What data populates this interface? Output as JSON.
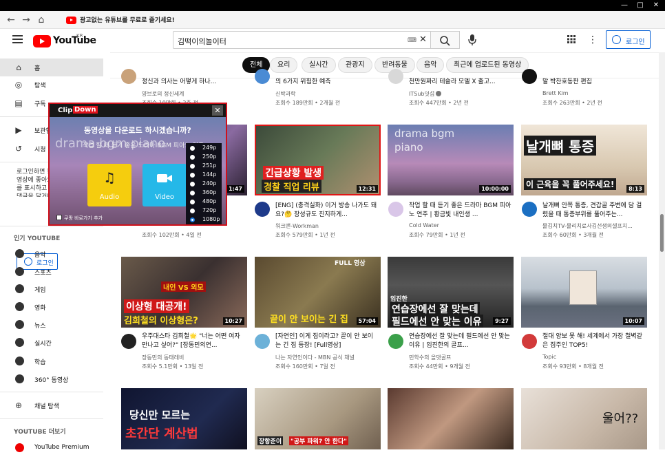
{
  "window": {
    "minimize": "—",
    "maximize": "□",
    "close": "✕"
  },
  "browser": {
    "back": "←",
    "forward": "→",
    "home": "⌂",
    "ad_text": "광고없는 유튜브를 무료로 즐기세요!"
  },
  "header": {
    "logo_text": "YouTube",
    "region": "KR",
    "search_value": "김떡이의놀이터",
    "signin_label": "로그인"
  },
  "chips": [
    "전체",
    "요리",
    "실시간",
    "관광지",
    "반려동물",
    "음악",
    "최근에 업로드된 동영상"
  ],
  "sidebar": {
    "items": [
      {
        "label": "홈",
        "icon": "home-icon"
      },
      {
        "label": "탐색",
        "icon": "compass-icon"
      },
      {
        "label": "구독",
        "icon": "subscriptions-icon"
      },
      {
        "label": "보관함",
        "icon": "library-icon"
      },
      {
        "label": "시청 기록",
        "icon": "history-icon"
      }
    ],
    "signin_text": "로그인하면 동영상에 좋아요를 표시하고 댓글을 달거나 구독할 수 있습니다.",
    "signin_label": "로그인",
    "popular_header": "인기 YOUTUBE",
    "categories": [
      "음악",
      "스포츠",
      "게임",
      "영화",
      "뉴스",
      "실시간",
      "학습",
      "360° 동영상"
    ],
    "browse_channels": "채널 탐색",
    "more_header": "YOUTUBE 더보기",
    "more_item": "YouTube Premium"
  },
  "rows": [
    [
      {
        "title": "정신과 의사는 어떻게 하나...",
        "channel": "양브로의 정신세계",
        "meta": "조회수 10만회 • 2주 전",
        "avatar": "#c9a27a"
      },
      {
        "title": "의 6가지 위험한 예측",
        "channel": "신박과학",
        "meta": "조회수 189만회 • 2개월 전",
        "avatar": "#4a8bd4"
      },
      {
        "title": "천만원짜리 테슬라 모델 X 출고...",
        "channel": "ITSub잇섭",
        "meta": "조회수 447만회 • 2년 전",
        "avatar": "#d8d8d8"
      },
      {
        "title": "말 박찬호동판 편집",
        "channel": "Brett Kim",
        "meta": "조회수 263만회 • 2년 전",
        "avatar": "#111111"
      }
    ],
    [
      {
        "title": "",
        "channel": "",
        "meta": "조회수 102만회 • 4일 전",
        "avatar": ""
      },
      {
        "title": "[ENG] (충격실화) 이거 방송 나가도 돼요?🤔 장성규도 진지하게...",
        "channel": "워크맨-Workman",
        "meta": "조회수 579만회 • 1년 전",
        "avatar": "#1e3a8a",
        "duration": "12:31"
      },
      {
        "title": "작업 할 때 듣기 좋은 드라마 BGM 피아노 연주 | 황금빛 내인생 ...",
        "channel": "Cold Water",
        "meta": "조회수 79만회 • 1년 전",
        "avatar": "#d9c6e8",
        "duration": "10:00:00"
      },
      {
        "title": "날개뼈 안쪽 통증, 견갑골 주변에 담 걸렸을 때 통증부위를 풀어주는...",
        "channel": "물김치TV-물리치료사김선생의셀프치...",
        "meta": "조회수 60만회 • 3개월 전",
        "avatar": "#1b6fc2",
        "duration": "8:13"
      }
    ],
    [
      {
        "title": "우주대스타 김희철🌟 \"너는 어떤 여자 만나고 싶어?\" [장동민의연...",
        "channel": "장동민의 동태레비",
        "meta": "조회수 5.1만회 • 13일 전",
        "avatar": "#222222",
        "duration": "10:27"
      },
      {
        "title": "[자연인] 이게 집이라고? 끝이 안 보이는 긴 집 등장! [Full영상]",
        "channel": "나는 자연인이다 - MBN 공식 채널",
        "meta": "조회수 160만회 • 7일 전",
        "avatar": "#6cb1d8",
        "duration": "57:04"
      },
      {
        "title": "연습장에선 잘 맞는데 필드에선 안 맞는 이유 | 임진한의 골프...",
        "channel": "민학수의 올댓골프",
        "meta": "조회수 44만회 • 9개월 전",
        "avatar": "#3ba04a",
        "duration": "9:27"
      },
      {
        "title": "절대 양보 못 해! 세계에서 가장 철벽같은 집주인 TOP5!",
        "channel": "Topic",
        "meta": "조회수 93만회 • 8개월 전",
        "avatar": "#d23a3a",
        "duration": "10:07"
      }
    ]
  ],
  "thumb_text": {
    "r1c0": "",
    "r1c1a": "긴급상황 발생",
    "r1c1b": "경찰 직업 리뷰",
    "r1c2a": "drama bgm",
    "r1c2b": "piano",
    "r1c3a": "날개뼈 통증",
    "r1c3b": "이 근육을 꼭 풀어주세요!",
    "r2c0a": "이상형 대공개!",
    "r2c0b": "김희철의 이상형은?",
    "r2c0c": "내인 VS 외모",
    "r2c1a": "끝이 안 보이는 긴 집",
    "r2c1b": "FULL 영상",
    "r2c2a": "연습장에선 잘 맞는데",
    "r2c2b": "필드에선 안 맞는 이유",
    "r2c2c": "임진한",
    "r3c0a": "당신만 모르는",
    "r3c0b": "초간단 계산법",
    "r3c1a": "장항준이",
    "r3c1b": "\"공부 파워? 안 한다\"",
    "r3c3a": "울어??"
  },
  "clip": {
    "logo_a": "Clip",
    "logo_b": "Down",
    "close": "✕",
    "question": "동영상을 다운로드 하시겠습니까?",
    "subtitle": "작업 할 때 듣기 좋은 드라마 BGM 피아노 연주",
    "watermark": "drama bgm piano",
    "audio_label": "Audio",
    "video_label": "Video",
    "resolutions": [
      "249p",
      "250p",
      "251p",
      "144p",
      "240p",
      "360p",
      "480p",
      "720p",
      "1080p"
    ],
    "selected": "1080p",
    "shortcut": "쿠팡 바로가기 추가"
  }
}
